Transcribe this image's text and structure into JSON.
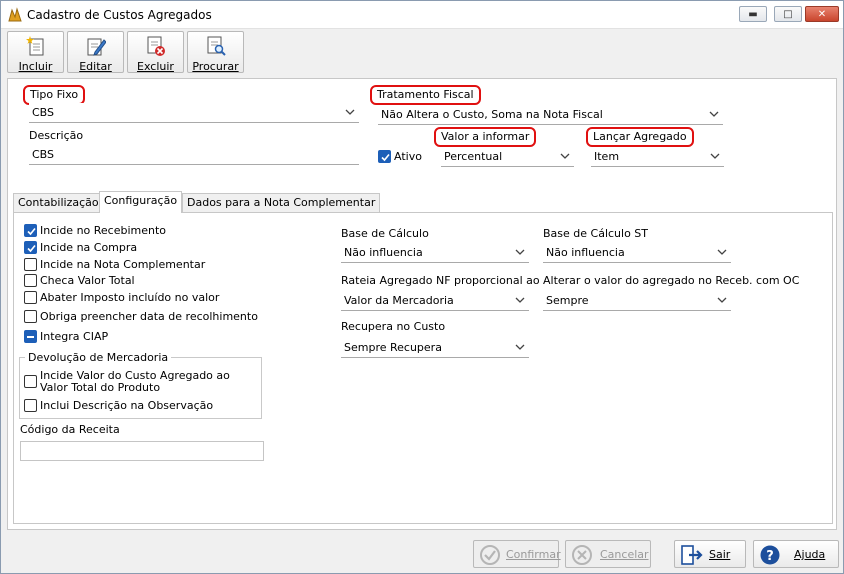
{
  "window": {
    "title": "Cadastro de Custos Agregados"
  },
  "toolbar": {
    "incluir": "Incluir",
    "editar": "Editar",
    "excluir": "Excluir",
    "procurar": "Procurar"
  },
  "form": {
    "tipo_fixo_label": "Tipo Fixo",
    "tipo_fixo_value": "CBS",
    "tratamento_fiscal_label": "Tratamento Fiscal",
    "tratamento_fiscal_value": "Não Altera o Custo, Soma na Nota Fiscal",
    "descricao_label": "Descrição",
    "descricao_value": "CBS",
    "ativo_label": "Ativo",
    "ativo_checked": true,
    "valor_informar_label": "Valor a informar",
    "valor_informar_value": "Percentual",
    "lancar_agregado_label": "Lançar Agregado",
    "lancar_agregado_value": "Item"
  },
  "tabs": [
    "Contabilização",
    "Configuração",
    "Dados para a Nota Complementar"
  ],
  "active_tab": "Configuração",
  "config": {
    "checks": [
      {
        "label": "Incide no Recebimento",
        "state": "checked"
      },
      {
        "label": "Incide na Compra",
        "state": "checked"
      },
      {
        "label": "Incide na Nota Complementar",
        "state": "unchecked"
      },
      {
        "label": "Checa Valor Total",
        "state": "unchecked"
      },
      {
        "label": "Abater Imposto incluído no valor",
        "state": "unchecked"
      },
      {
        "label": "Obriga preencher data de recolhimento",
        "state": "unchecked"
      },
      {
        "label": "Integra CIAP",
        "state": "indeterminate"
      }
    ],
    "devolucao_title": "Devolução de Mercadoria",
    "devolucao_check1": "Incide Valor do Custo Agregado ao Valor Total do Produto",
    "devolucao_check2": "Inclui Descrição na Observação",
    "codigo_receita_label": "Código da Receita",
    "codigo_receita_value": "",
    "base_calculo_label": "Base de Cálculo",
    "base_calculo_value": "Não influencia",
    "base_calculo_st_label": "Base de Cálculo ST",
    "base_calculo_st_value": "Não influencia",
    "rateia_label": "Rateia Agregado NF proporcional ao",
    "rateia_value": "Valor da Mercadoria",
    "alterar_label": "Alterar o valor do agregado no Receb. com OC",
    "alterar_value": "Sempre",
    "recupera_label": "Recupera no Custo",
    "recupera_value": "Sempre Recupera"
  },
  "footer": {
    "confirmar": "Confirmar",
    "cancelar": "Cancelar",
    "sair": "Sair",
    "ajuda": "Ajuda"
  },
  "colors": {
    "highlight": "#e01010",
    "check": "#1d5fb8"
  }
}
